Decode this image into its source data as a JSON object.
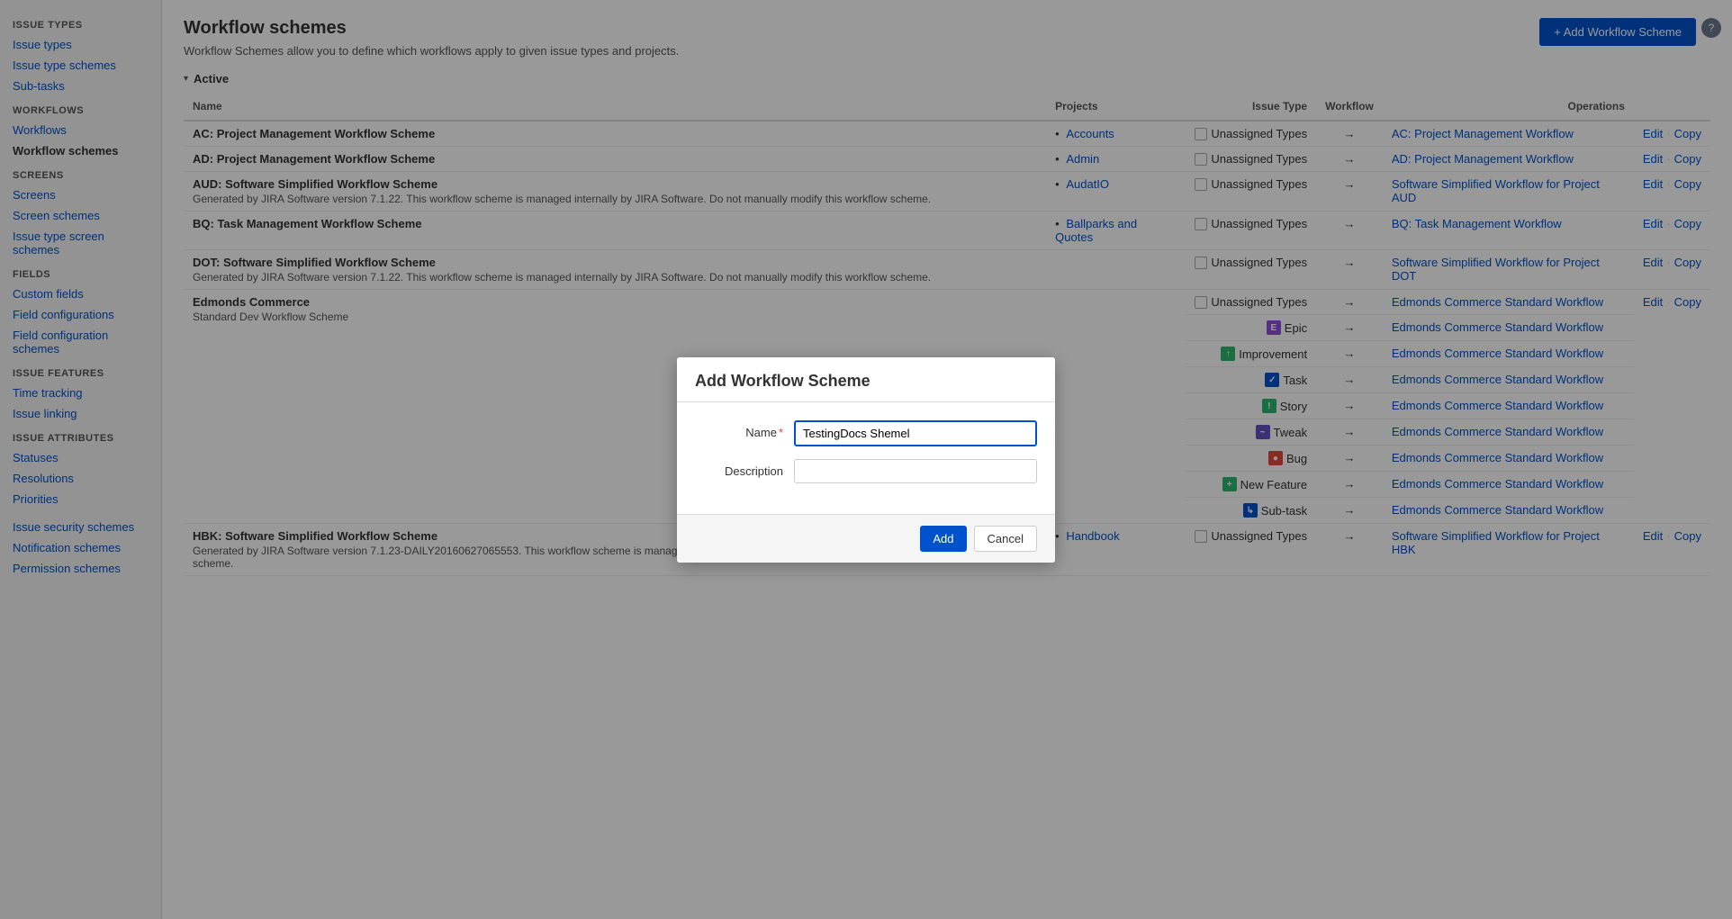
{
  "sidebar": {
    "sections": [
      {
        "title": "ISSUE TYPES",
        "items": [
          {
            "id": "issue-types",
            "label": "Issue types",
            "active": false
          },
          {
            "id": "issue-type-schemes",
            "label": "Issue type schemes",
            "active": false
          },
          {
            "id": "sub-tasks",
            "label": "Sub-tasks",
            "active": false
          }
        ]
      },
      {
        "title": "WORKFLOWS",
        "items": [
          {
            "id": "workflows",
            "label": "Workflows",
            "active": false
          },
          {
            "id": "workflow-schemes",
            "label": "Workflow schemes",
            "active": true
          }
        ]
      },
      {
        "title": "SCREENS",
        "items": [
          {
            "id": "screens",
            "label": "Screens",
            "active": false
          },
          {
            "id": "screen-schemes",
            "label": "Screen schemes",
            "active": false
          },
          {
            "id": "issue-type-screen-schemes",
            "label": "Issue type screen schemes",
            "active": false
          }
        ]
      },
      {
        "title": "FIELDS",
        "items": [
          {
            "id": "custom-fields",
            "label": "Custom fields",
            "active": false
          },
          {
            "id": "field-configurations",
            "label": "Field configurations",
            "active": false
          },
          {
            "id": "field-configuration-schemes",
            "label": "Field configuration schemes",
            "active": false
          }
        ]
      },
      {
        "title": "ISSUE FEATURES",
        "items": [
          {
            "id": "time-tracking",
            "label": "Time tracking",
            "active": false
          },
          {
            "id": "issue-linking",
            "label": "Issue linking",
            "active": false
          }
        ]
      },
      {
        "title": "ISSUE ATTRIBUTES",
        "items": [
          {
            "id": "statuses",
            "label": "Statuses",
            "active": false
          },
          {
            "id": "resolutions",
            "label": "Resolutions",
            "active": false
          },
          {
            "id": "priorities",
            "label": "Priorities",
            "active": false
          }
        ]
      },
      {
        "title": "",
        "items": [
          {
            "id": "issue-security-schemes",
            "label": "Issue security schemes",
            "active": false
          },
          {
            "id": "notification-schemes",
            "label": "Notification schemes",
            "active": false
          },
          {
            "id": "permission-schemes",
            "label": "Permission schemes",
            "active": false
          }
        ]
      }
    ]
  },
  "page": {
    "title": "Workflow schemes",
    "description": "Workflow Schemes allow you to define which workflows apply to given issue types and projects.",
    "add_button": "+ Add Workflow Scheme",
    "help_text": "?",
    "active_section": "Active"
  },
  "table": {
    "headers": {
      "name": "Name",
      "projects": "Projects",
      "issue_type": "Issue Type",
      "workflow": "Workflow",
      "operations": "Operations"
    },
    "rows": [
      {
        "name": "AC: Project Management Workflow Scheme",
        "description": "",
        "projects": [
          {
            "label": "Accounts",
            "link": "#"
          }
        ],
        "issue_types": [
          {
            "icon": "unassigned",
            "label": "Unassigned Types"
          }
        ],
        "workflows": [
          {
            "label": "AC: Project Management Workflow",
            "link": "#"
          }
        ],
        "ops": [
          {
            "label": "Edit",
            "link": "#"
          },
          {
            "label": "Copy",
            "link": "#"
          }
        ]
      },
      {
        "name": "AD: Project Management Workflow Scheme",
        "description": "",
        "projects": [
          {
            "label": "Admin",
            "link": "#"
          }
        ],
        "issue_types": [
          {
            "icon": "unassigned",
            "label": "Unassigned Types"
          }
        ],
        "workflows": [
          {
            "label": "AD: Project Management Workflow",
            "link": "#"
          }
        ],
        "ops": [
          {
            "label": "Edit",
            "link": "#"
          },
          {
            "label": "Copy",
            "link": "#"
          }
        ]
      },
      {
        "name": "AUD: Software Simplified Workflow Scheme",
        "description": "Generated by JIRA Software version 7.1.22. This workflow scheme is managed internally by JIRA Software. Do not manually modify this workflow scheme.",
        "projects": [
          {
            "label": "AudatIO",
            "link": "#"
          }
        ],
        "issue_types": [
          {
            "icon": "unassigned",
            "label": "Unassigned Types"
          }
        ],
        "workflows": [
          {
            "label": "Software Simplified Workflow for Project AUD",
            "link": "#"
          }
        ],
        "ops": [
          {
            "label": "Edit",
            "link": "#"
          },
          {
            "label": "Copy",
            "link": "#"
          }
        ]
      },
      {
        "name": "BQ: Task Management Workflow Scheme",
        "description": "",
        "projects": [
          {
            "label": "Ballparks and Quotes",
            "link": "#"
          }
        ],
        "issue_types": [
          {
            "icon": "unassigned",
            "label": "Unassigned Types"
          }
        ],
        "workflows": [
          {
            "label": "BQ: Task Management Workflow",
            "link": "#"
          }
        ],
        "ops": [
          {
            "label": "Edit",
            "link": "#"
          },
          {
            "label": "Copy",
            "link": "#"
          }
        ]
      },
      {
        "name": "DOT: Software Simplified Workflow Scheme",
        "description": "Generated by JIRA Software version 7.1.22. This workflow scheme is managed internally by JIRA Software. Do not manually modify this workflow scheme.",
        "projects": [],
        "issue_types": [
          {
            "icon": "unassigned",
            "label": "Unassigned Types"
          }
        ],
        "workflows": [
          {
            "label": "Software Simplified Workflow for Project DOT",
            "link": "#"
          }
        ],
        "ops": [
          {
            "label": "Edit",
            "link": "#"
          },
          {
            "label": "Copy",
            "link": "#"
          }
        ]
      },
      {
        "name": "Edmonds Commerce",
        "description": "Standard Dev Workflow Scheme",
        "projects": [],
        "issue_types": [
          {
            "icon": "unassigned",
            "label": "Unassigned Types"
          },
          {
            "icon": "epic",
            "label": "Epic"
          },
          {
            "icon": "improvement",
            "label": "Improvement"
          },
          {
            "icon": "task",
            "label": "Task"
          },
          {
            "icon": "story",
            "label": "Story"
          },
          {
            "icon": "tweak",
            "label": "Tweak"
          },
          {
            "icon": "bug",
            "label": "Bug"
          },
          {
            "icon": "new-feature",
            "label": "New Feature"
          },
          {
            "icon": "subtask",
            "label": "Sub-task"
          }
        ],
        "workflows": [
          {
            "label": "Edmonds Commerce Standard Workflow",
            "link": "#"
          },
          {
            "label": "Edmonds Commerce Standard Workflow",
            "link": "#"
          },
          {
            "label": "Edmonds Commerce Standard Workflow",
            "link": "#"
          },
          {
            "label": "Edmonds Commerce Standard Workflow",
            "link": "#"
          },
          {
            "label": "Edmonds Commerce Standard Workflow",
            "link": "#"
          },
          {
            "label": "Edmonds Commerce Standard Workflow",
            "link": "#"
          },
          {
            "label": "Edmonds Commerce Standard Workflow",
            "link": "#"
          },
          {
            "label": "Edmonds Commerce Standard Workflow",
            "link": "#"
          },
          {
            "label": "Edmonds Commerce Standard Workflow",
            "link": "#"
          }
        ],
        "ops": [
          {
            "label": "Edit",
            "link": "#"
          },
          {
            "label": "Copy",
            "link": "#"
          }
        ]
      },
      {
        "name": "HBK: Software Simplified Workflow Scheme",
        "description": "Generated by JIRA Software version 7.1.23-DAILY20160627065553. This workflow scheme is managed internally by JIRA Software. Do not manually modify this workflow scheme.",
        "projects": [
          {
            "label": "Handbook",
            "link": "#"
          }
        ],
        "issue_types": [
          {
            "icon": "unassigned",
            "label": "Unassigned Types"
          }
        ],
        "workflows": [
          {
            "label": "Software Simplified Workflow for Project HBK",
            "link": "#"
          }
        ],
        "ops": [
          {
            "label": "Edit",
            "link": "#"
          },
          {
            "label": "Copy",
            "link": "#"
          }
        ]
      }
    ]
  },
  "modal": {
    "title": "Add Workflow Scheme",
    "name_label": "Name",
    "name_required": "*",
    "name_value": "TestingDocs Shemel",
    "description_label": "Description",
    "description_value": "",
    "add_button": "Add",
    "cancel_button": "Cancel"
  }
}
